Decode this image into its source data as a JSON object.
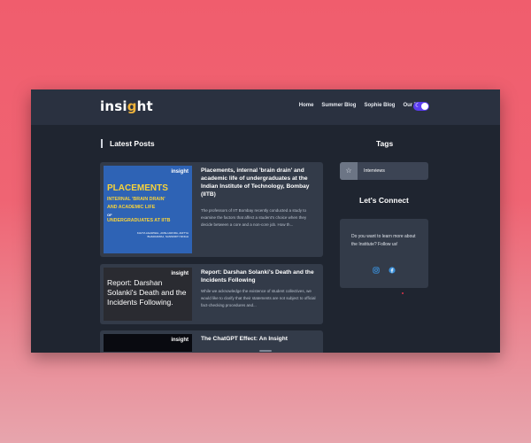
{
  "header": {
    "logo_main": "insi",
    "logo_dot": "g",
    "logo_end": "ht",
    "nav": [
      "Home",
      "Summer Blog",
      "Sophie Blog",
      "Our Team"
    ]
  },
  "latest_posts": {
    "title": "Latest Posts",
    "posts": [
      {
        "thumb": {
          "logo": "insight",
          "line1": "PLACEMENTS",
          "line2": "INTERNAL 'BRAIN DRAIN'",
          "line3": "AND ACADEMIC LIFE",
          "line4": "OF",
          "line5": "UNDERGRADUATES AT IITB",
          "footer": "KAVYA AGARWAL, ANSH ARORA, ADITYA BHARADWAJ, SANSKRITI SINGH"
        },
        "title": "Placements, internal 'brain drain' and academic life of undergraduates at the Indian Institute of Technology, Bombay (IITB)",
        "excerpt": "The professors of IIT Bombay recently conducted a study to examine the factors that affect a student's choice when they decide between a core and a non-core job. How th..."
      },
      {
        "thumb": {
          "logo": "insight",
          "headline": "Report: Darshan Solanki's Death and the Incidents Following."
        },
        "title": "Report: Darshan Solanki's Death and the Incidents Following",
        "excerpt": "While we acknowledge the existence of student collectives, we would like to clarify that their statements are not subject to official fact-checking procedures and..."
      },
      {
        "thumb": {
          "logo": "insight"
        },
        "title": "The ChatGPT Effect: An Insight"
      }
    ]
  },
  "tags": {
    "title": "Tags",
    "items": [
      {
        "label": "Interviews",
        "icon": "tag-icon"
      }
    ]
  },
  "connect": {
    "title": "Let's Connect",
    "text": "Do you want to learn more about the Institute? Follow us!",
    "instagram_color": "#3a8fd9",
    "facebook_color": "#3a8fd9"
  },
  "colors": {
    "accent": "#5b3df0",
    "thumb_yellow": "#f7d23a"
  }
}
